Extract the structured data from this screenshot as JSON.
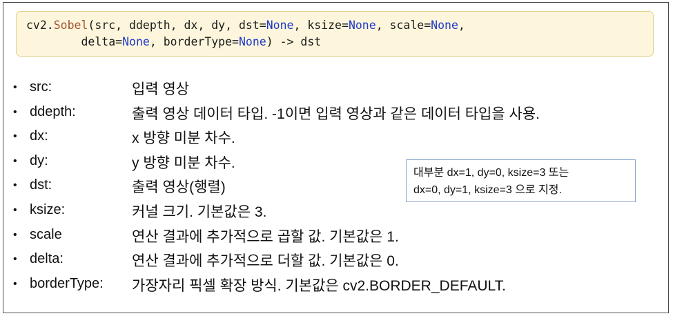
{
  "signature": {
    "module": "cv2.",
    "func": "Sobel",
    "line1_args": "(src, ddepth, dx, dy, dst=",
    "none": "None",
    "sep_ksize": ", ksize=",
    "sep_scale": ", scale=",
    "line1_end": ",",
    "line2_indent": "        ",
    "line2_delta": "delta=",
    "sep_border": ", borderType=",
    "line2_end": ") -> dst"
  },
  "params": [
    {
      "name": "src:",
      "desc": "입력 영상"
    },
    {
      "name": "ddepth:",
      "desc": "출력 영상 데이터 타입. -1이면 입력 영상과 같은 데이터 타입을 사용."
    },
    {
      "name": "dx:",
      "desc": "x 방향 미분 차수."
    },
    {
      "name": "dy:",
      "desc": "y 방향 미분 차수."
    },
    {
      "name": "dst:",
      "desc": "출력 영상(행렬)"
    },
    {
      "name": "ksize:",
      "desc": "커널 크기. 기본값은 3."
    },
    {
      "name": "scale",
      "desc": "연산 결과에 추가적으로 곱할 값. 기본값은 1."
    },
    {
      "name": "delta:",
      "desc": "연산 결과에 추가적으로 더할 값. 기본값은 0."
    },
    {
      "name": "borderType:",
      "desc": "가장자리 픽셀 확장 방식. 기본값은 cv2.BORDER_DEFAULT."
    }
  ],
  "bullet": "•",
  "note": {
    "line1": "대부분 dx=1, dy=0, ksize=3 또는",
    "line2": "dx=0, dy=1, ksize=3 으로 지정."
  }
}
